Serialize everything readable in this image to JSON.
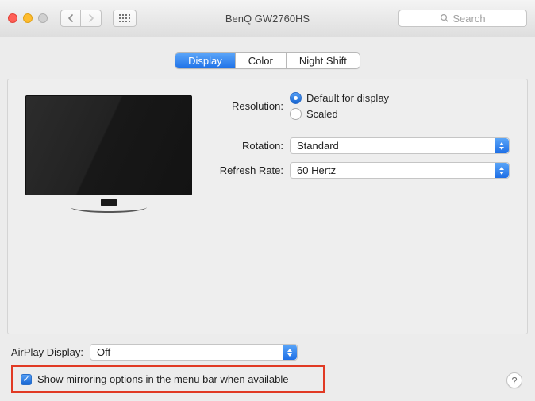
{
  "window": {
    "title": "BenQ GW2760HS",
    "search_placeholder": "Search"
  },
  "tabs": [
    "Display",
    "Color",
    "Night Shift"
  ],
  "active_tab": "Display",
  "labels": {
    "resolution": "Resolution:",
    "rotation": "Rotation:",
    "refresh_rate": "Refresh Rate:",
    "airplay": "AirPlay Display:"
  },
  "resolution_options": [
    "Default for display",
    "Scaled"
  ],
  "resolution_selected": "Default for display",
  "rotation": "Standard",
  "refresh_rate": "60 Hertz",
  "airplay": "Off",
  "mirroring_label": "Show mirroring options in the menu bar when available",
  "mirroring_checked": true
}
